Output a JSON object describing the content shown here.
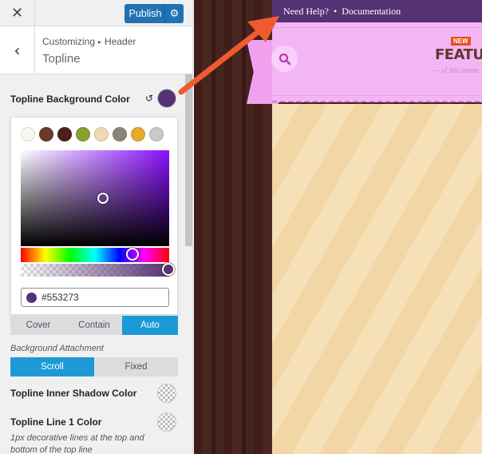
{
  "topbar": {
    "close_icon": "close-icon",
    "publish_label": "Publish",
    "publish_settings_icon": "gear-icon"
  },
  "section": {
    "breadcrumb_parent": "Customizing",
    "breadcrumb_child": "Header",
    "title": "Topline"
  },
  "controls": {
    "bg_color_label": "Topline Background Color",
    "bg_color_value": "#553273",
    "palette": [
      "#faf6f2",
      "#6b3a2a",
      "#4a2018",
      "#8aa02c",
      "#efd9b4",
      "#8a8478",
      "#e7a92b",
      "#c9c9c9"
    ],
    "hex_value": "#553273",
    "size_options": [
      "Cover",
      "Contain",
      "Auto"
    ],
    "size_selected": "Auto",
    "attachment_label": "Background Attachment",
    "attachment_options": [
      "Scroll",
      "Fixed"
    ],
    "attachment_selected": "Scroll",
    "inner_shadow_label": "Topline Inner Shadow Color",
    "line1_label": "Topline Line 1 Color",
    "line1_description": "1px decorative lines at the top and bottom of the top line"
  },
  "preview": {
    "need_help": "Need Help?",
    "separator": "•",
    "documentation": "Documentation",
    "new_badge": "NEW",
    "features": "FEATURES",
    "of_this_theme": "— of this theme",
    "topline_color": "#553273",
    "arrow_color": "#ef5a2f"
  }
}
